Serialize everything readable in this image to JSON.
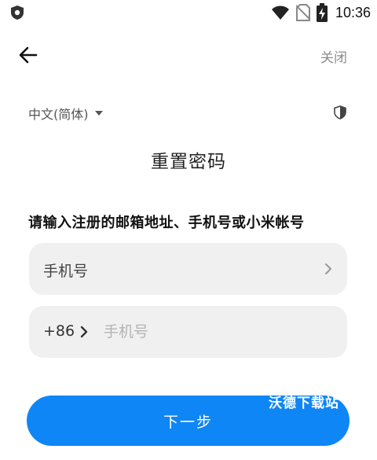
{
  "status_bar": {
    "time": "10:36",
    "icons": [
      "shield-icon",
      "wifi-icon",
      "no-sim-icon",
      "battery-charging-icon"
    ]
  },
  "header": {
    "back_icon": "back-arrow-icon",
    "close_label": "关闭"
  },
  "language": {
    "selected": "中文(简体)",
    "caret_icon": "caret-down-icon"
  },
  "security_icon": "security-shield-icon",
  "page_title": "重置密码",
  "instruction": "请输入注册的邮箱地址、手机号或小米帐号",
  "form": {
    "region_label": "手机号",
    "country_code": "+86",
    "phone_placeholder": "手机号",
    "phone_value": ""
  },
  "next_button_label": "下一步",
  "watermark": "沃德下载站",
  "colors": {
    "accent": "#0f86f5",
    "field_bg": "#f0f0f0",
    "muted_text": "#8c8c8c"
  }
}
